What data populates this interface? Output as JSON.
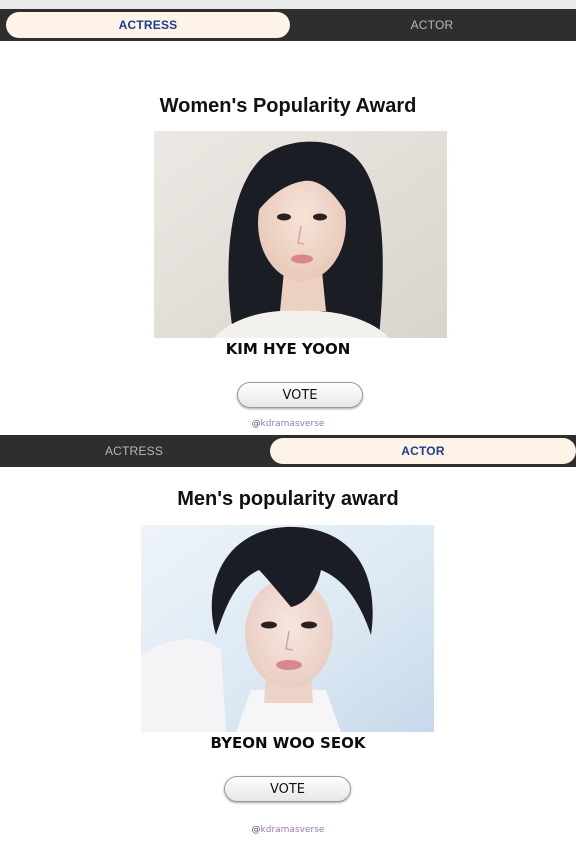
{
  "top_tabs": {
    "actress": "ACTRESS",
    "actor": "ACTOR",
    "active": "actress"
  },
  "women": {
    "title": "Women's Popularity Award",
    "name": "KIM HYE YOON",
    "vote_label": "VOTE",
    "handle_at": "@",
    "handle": "kdramasverse",
    "photo_icon": "portrait-photo"
  },
  "bottom_tabs": {
    "actress": "ACTRESS",
    "actor": "ACTOR",
    "active": "actor"
  },
  "men": {
    "title": "Men's popularity award",
    "name": "BYEON WOO SEOK",
    "vote_label": "VOTE",
    "handle_at": "@",
    "handle": "kdramasverse",
    "photo_icon": "portrait-photo"
  },
  "colors": {
    "tabbar": "#2e2e2e",
    "active_tab": "#fdf3e7",
    "active_tab_text": "#1e3d8f",
    "handle_text": "#9b79b8"
  }
}
